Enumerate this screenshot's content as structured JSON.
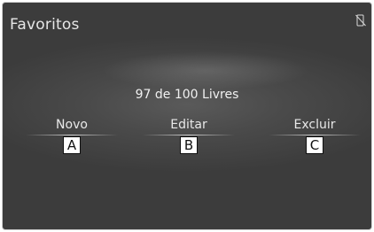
{
  "header": {
    "title": "Favoritos",
    "corner_icon": "phone-no-signal-icon"
  },
  "status": {
    "text": "97 de 100 Livres"
  },
  "actions": [
    {
      "label": "Novo",
      "callout": "A"
    },
    {
      "label": "Editar",
      "callout": "B"
    },
    {
      "label": "Excluir",
      "callout": "C"
    }
  ]
}
